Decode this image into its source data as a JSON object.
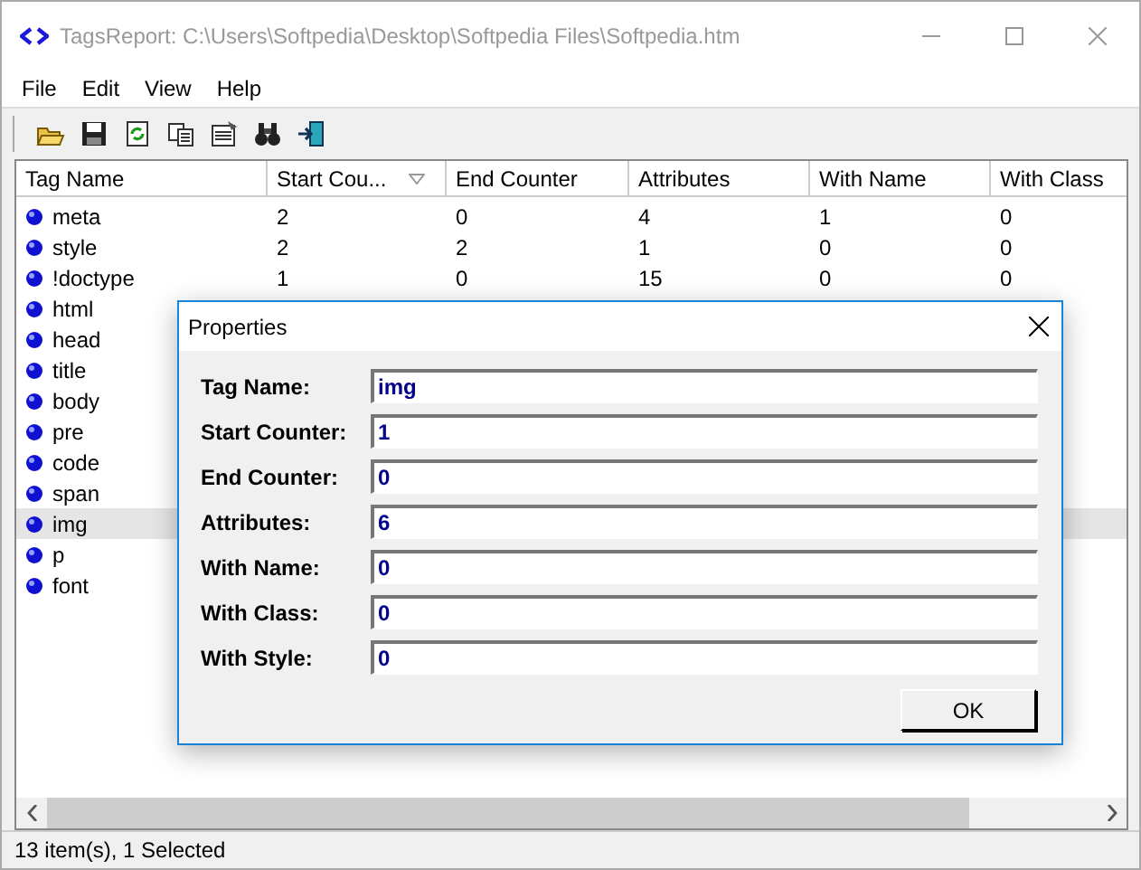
{
  "window": {
    "title": "TagsReport: C:\\Users\\Softpedia\\Desktop\\Softpedia Files\\Softpedia.htm"
  },
  "menu": [
    "File",
    "Edit",
    "View",
    "Help"
  ],
  "table": {
    "columns": [
      {
        "label": "Tag Name",
        "sorted": false
      },
      {
        "label": "Start Cou...",
        "sorted": true
      },
      {
        "label": "End Counter",
        "sorted": false
      },
      {
        "label": "Attributes",
        "sorted": false
      },
      {
        "label": "With Name",
        "sorted": false
      },
      {
        "label": "With Class",
        "sorted": false
      }
    ],
    "rows": [
      {
        "cells": [
          "meta",
          "2",
          "0",
          "4",
          "1",
          "0"
        ],
        "selected": false
      },
      {
        "cells": [
          "style",
          "2",
          "2",
          "1",
          "0",
          "0"
        ],
        "selected": false
      },
      {
        "cells": [
          "!doctype",
          "1",
          "0",
          "15",
          "0",
          "0"
        ],
        "selected": false
      },
      {
        "cells": [
          "html"
        ],
        "selected": false
      },
      {
        "cells": [
          "head"
        ],
        "selected": false
      },
      {
        "cells": [
          "title"
        ],
        "selected": false
      },
      {
        "cells": [
          "body"
        ],
        "selected": false
      },
      {
        "cells": [
          "pre"
        ],
        "selected": false
      },
      {
        "cells": [
          "code"
        ],
        "selected": false
      },
      {
        "cells": [
          "span"
        ],
        "selected": false
      },
      {
        "cells": [
          "img"
        ],
        "selected": true
      },
      {
        "cells": [
          "p"
        ],
        "selected": false
      },
      {
        "cells": [
          "font"
        ],
        "selected": false
      }
    ]
  },
  "dialog": {
    "title": "Properties",
    "fields": [
      {
        "label": "Tag Name:",
        "value": "img"
      },
      {
        "label": "Start Counter:",
        "value": "1"
      },
      {
        "label": "End Counter:",
        "value": "0"
      },
      {
        "label": "Attributes:",
        "value": "6"
      },
      {
        "label": "With Name:",
        "value": "0"
      },
      {
        "label": "With Class:",
        "value": "0"
      },
      {
        "label": "With Style:",
        "value": "0"
      }
    ],
    "button": "OK"
  },
  "status_bar": "13 item(s), 1 Selected"
}
